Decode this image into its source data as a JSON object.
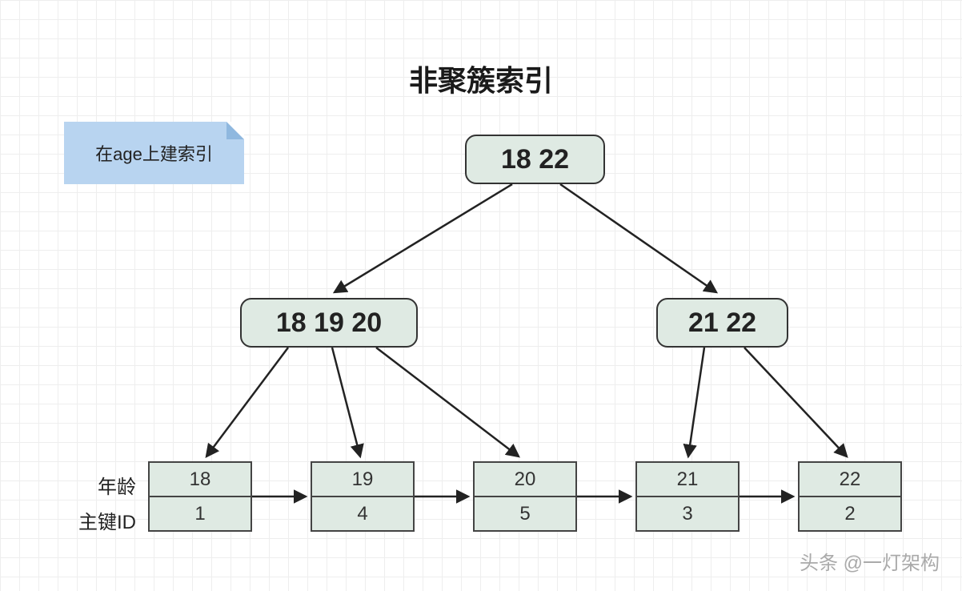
{
  "title": "非聚簇索引",
  "note": "在age上建索引",
  "root": {
    "label": "18 22"
  },
  "internal": {
    "left": {
      "label": "18 19 20"
    },
    "right": {
      "label": "21 22"
    }
  },
  "row_labels": {
    "age": "年龄",
    "pk": "主键ID"
  },
  "leaves": [
    {
      "age": "18",
      "pk": "1"
    },
    {
      "age": "19",
      "pk": "4"
    },
    {
      "age": "20",
      "pk": "5"
    },
    {
      "age": "21",
      "pk": "3"
    },
    {
      "age": "22",
      "pk": "2"
    }
  ],
  "watermark": "头条 @一灯架构"
}
